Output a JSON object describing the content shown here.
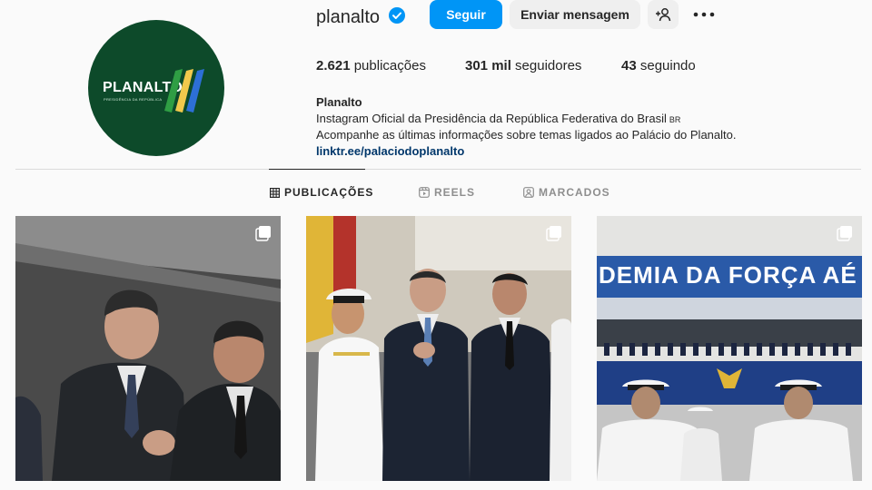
{
  "profile": {
    "username": "planalto",
    "avatar_title": "PLANALTO",
    "avatar_subtitle": "PRESIDÊNCIA DA REPÚBLICA"
  },
  "actions": {
    "follow_label": "Seguir",
    "message_label": "Enviar mensagem",
    "suggest_icon": "add-person-icon",
    "more_icon": "more-horizontal-icon"
  },
  "stats": {
    "posts_count": "2.621",
    "posts_label": "publicações",
    "followers_count": "301 mil",
    "followers_label": "seguidores",
    "following_count": "43",
    "following_label": "seguindo"
  },
  "bio": {
    "name": "Planalto",
    "line1": "Instagram Oficial da Presidência da República Federativa do Brasil",
    "flag": "BR",
    "line2": "Acompanhe as últimas informações sobre temas ligados ao Palácio do Planalto.",
    "link": "linktr.ee/palaciodoplanalto"
  },
  "tabs": [
    {
      "label": "PUBLICAÇÕES",
      "icon": "grid-icon",
      "active": true
    },
    {
      "label": "REELS",
      "icon": "reels-icon",
      "active": false
    },
    {
      "label": "MARCADOS",
      "icon": "tagged-icon",
      "active": false
    }
  ],
  "posts": {
    "post3_banner": "DEMIA DA FORÇA AÉ"
  },
  "colors": {
    "accent": "#0095f6",
    "link": "#00376b",
    "avatar_bg": "#0d4a2a"
  }
}
